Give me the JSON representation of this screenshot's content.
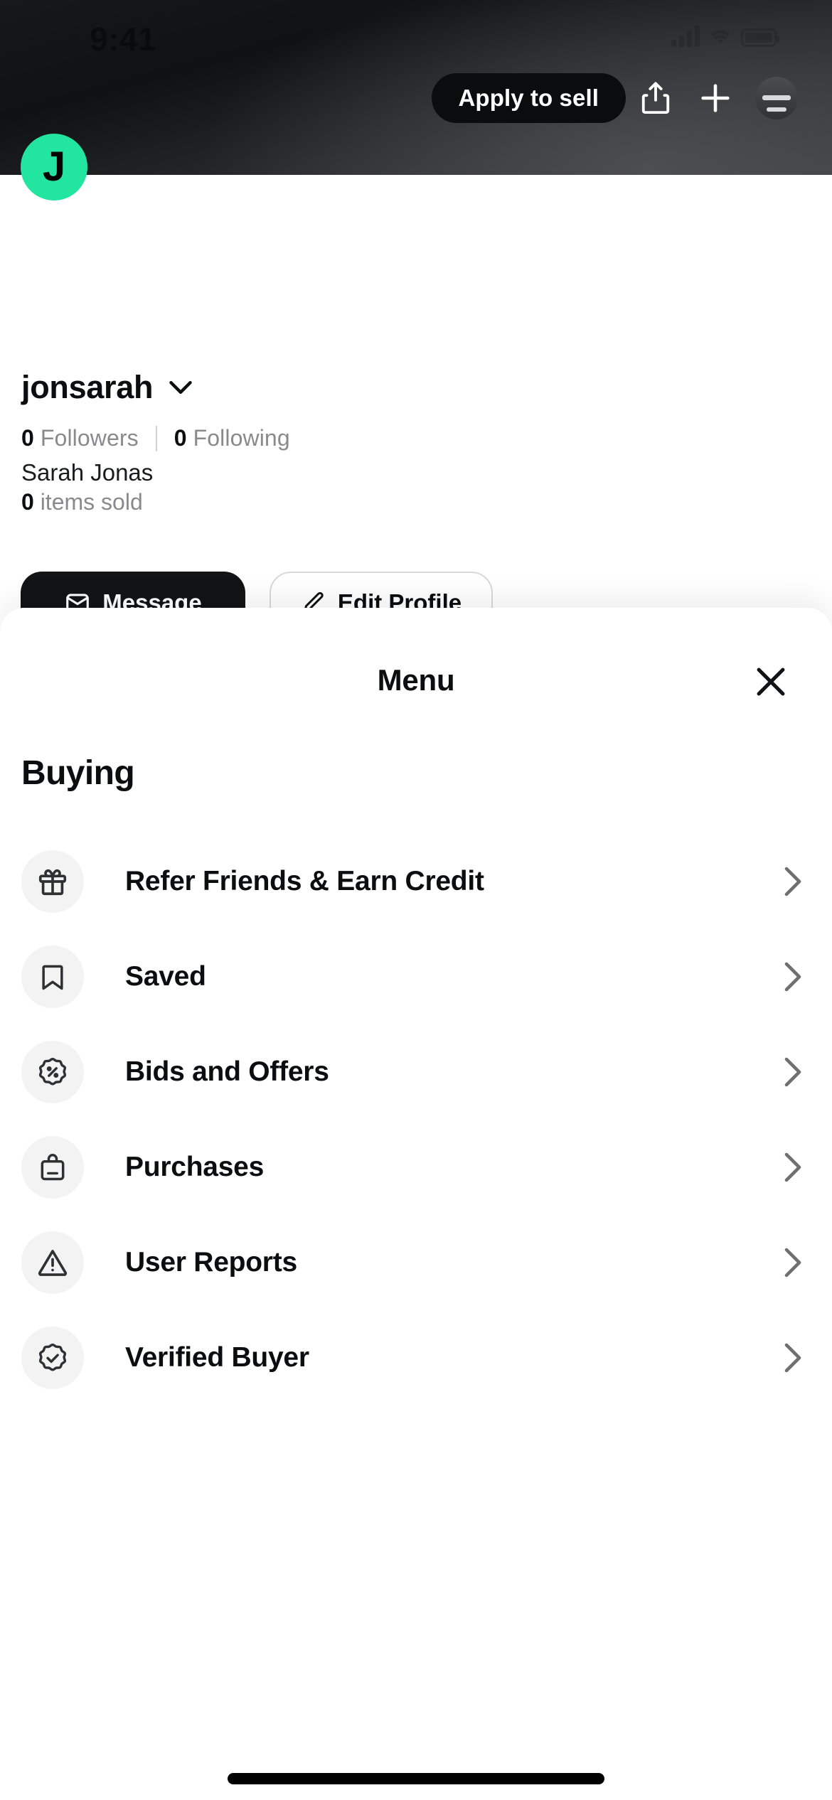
{
  "status_bar": {
    "time": "9:41",
    "signal_icon": "cellular-signal-icon",
    "wifi_icon": "wifi-icon",
    "battery_icon": "battery-icon"
  },
  "header": {
    "apply_label": "Apply to sell",
    "share_icon": "share-icon",
    "add_icon": "plus-icon",
    "account_icon": "account-avatar-icon"
  },
  "profile": {
    "avatar_initial": "J",
    "avatar_color": "#22E6A0",
    "username": "jonsarah",
    "chevron_icon": "chevron-down-icon",
    "followers_count": "0",
    "followers_label": "Followers",
    "following_count": "0",
    "following_label": "Following",
    "full_name": "Sarah Jonas",
    "items_sold_count": "0",
    "items_sold_label": "items sold",
    "primary_button": "Message",
    "secondary_button": "Edit Profile"
  },
  "sheet": {
    "title": "Menu",
    "close_icon": "close-icon",
    "section_title": "Buying",
    "items": [
      {
        "label": "Refer Friends & Earn Credit",
        "icon": "gift-icon",
        "chevron": "chevron-right-icon"
      },
      {
        "label": "Saved",
        "icon": "bookmark-icon",
        "chevron": "chevron-right-icon"
      },
      {
        "label": "Bids and Offers",
        "icon": "percent-badge-icon",
        "chevron": "chevron-right-icon"
      },
      {
        "label": "Purchases",
        "icon": "shopping-bag-icon",
        "chevron": "chevron-right-icon"
      },
      {
        "label": "User Reports",
        "icon": "warning-triangle-icon",
        "chevron": "chevron-right-icon"
      },
      {
        "label": "Verified Buyer",
        "icon": "verified-check-badge-icon",
        "chevron": "chevron-right-icon"
      }
    ]
  },
  "home_indicator": "home-indicator"
}
